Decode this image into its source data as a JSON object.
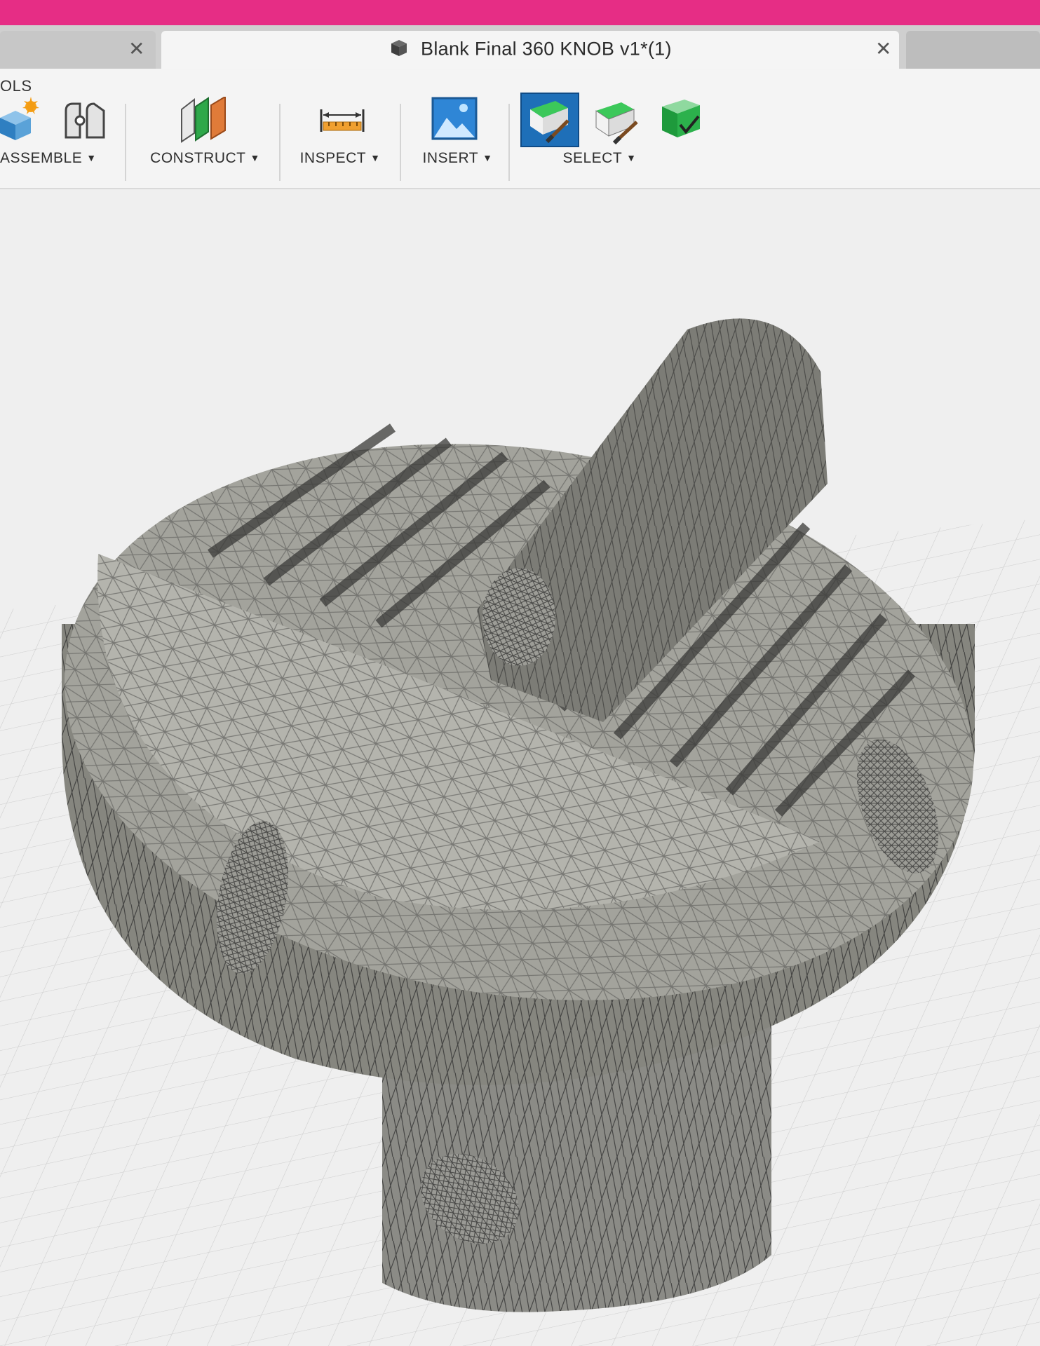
{
  "window": {
    "tabs": [
      {
        "title": "",
        "close": "✕"
      },
      {
        "title": "Blank Final 360 KNOB v1*(1)",
        "close": "✕",
        "active": true
      }
    ]
  },
  "toolbar": {
    "tools_label": "OLS",
    "groups": {
      "assemble": "ASSEMBLE",
      "construct": "CONSTRUCT",
      "inspect": "INSPECT",
      "insert": "INSERT",
      "select": "SELECT"
    }
  },
  "colors": {
    "accent_bar": "#e62d85",
    "select_active": "#1e6fb8",
    "model_gray": "#8a8a85"
  },
  "icons": {
    "document": "cube-document-icon",
    "assemble": [
      "new-component-icon",
      "joint-icon"
    ],
    "construct": "offset-plane-icon",
    "inspect": "measure-icon",
    "insert": "insert-image-icon",
    "select": [
      "select-icon",
      "paint-select-icon",
      "selection-filter-icon"
    ]
  }
}
